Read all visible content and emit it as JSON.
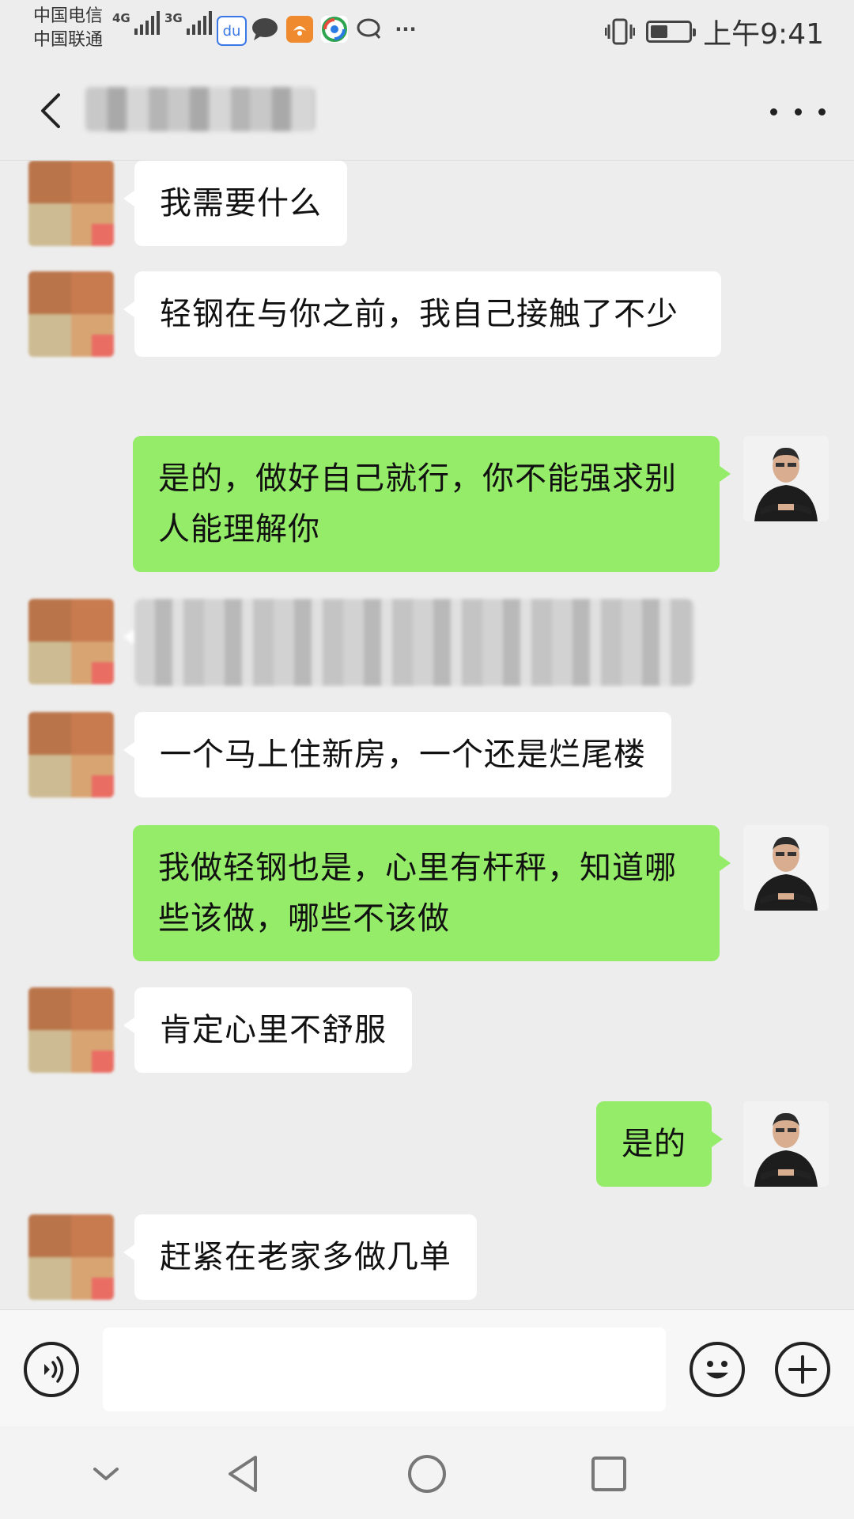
{
  "status_bar": {
    "carrier_1": "中国电信",
    "carrier_2": "中国联通",
    "network_1": "4G",
    "network_2": "3G",
    "time": "上午9:41",
    "battery_level": 0.45
  },
  "header": {
    "contact_name": "",
    "back_icon": "chevron-left-icon",
    "more_icon": "more-dots-icon"
  },
  "messages": [
    {
      "side": "left",
      "text": "我需要什么"
    },
    {
      "side": "left",
      "text": "轻钢在与你之前，我自己接触了不少"
    },
    {
      "side": "right",
      "text": "是的，做好自己就行，你不能强求别人能理解你"
    },
    {
      "side": "left",
      "text": "",
      "blurred": true
    },
    {
      "side": "left",
      "text": "一个马上住新房，一个还是烂尾楼"
    },
    {
      "side": "right",
      "text": "我做轻钢也是，心里有杆秤，知道哪些该做，哪些不该做"
    },
    {
      "side": "left",
      "text": "肯定心里不舒服"
    },
    {
      "side": "right",
      "text": "是的"
    },
    {
      "side": "left",
      "text": "赶紧在老家多做几单"
    }
  ],
  "input_bar": {
    "voice_icon": "voice-icon",
    "emoji_icon": "emoji-icon",
    "plus_icon": "plus-icon",
    "input_value": ""
  },
  "nav_bar": {
    "icons": [
      "chevron-down-icon",
      "back-triangle-icon",
      "home-circle-icon",
      "recents-square-icon"
    ]
  },
  "colors": {
    "background": "#ededed",
    "self_bubble": "#95ec69",
    "other_bubble": "#ffffff"
  }
}
